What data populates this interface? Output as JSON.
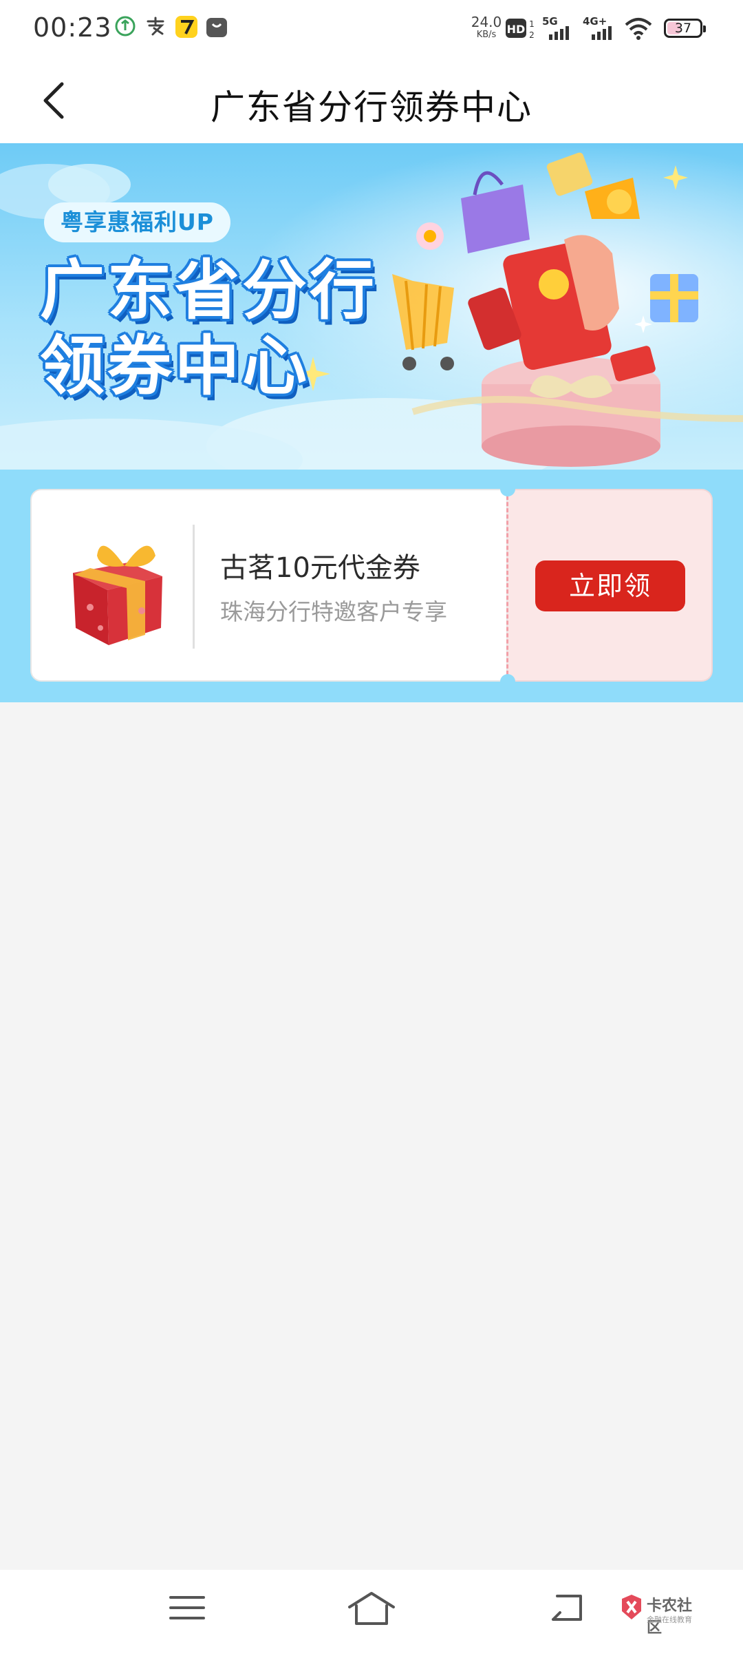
{
  "status_bar": {
    "time": "00:23",
    "net_speed_value": "24.0",
    "net_speed_unit": "KB/s",
    "hd_label": "HD",
    "signal_5g": "5G",
    "signal_4g": "4G+",
    "battery": "37"
  },
  "header": {
    "title": "广东省分行领券中心"
  },
  "banner": {
    "tag": "粤享惠福利UP",
    "title_line1": "广东省分行",
    "title_line2": "领券中心"
  },
  "coupon": {
    "title": "古茗10元代金券",
    "subtitle": "珠海分行特邀客户专享",
    "button": "立即领"
  },
  "watermark": {
    "name": "卡农社区",
    "tagline": "金融在线教育"
  },
  "colors": {
    "accent_red": "#d9251d",
    "coupon_bg": "#8fdcfa",
    "banner_blue": "#1f7fe0"
  }
}
